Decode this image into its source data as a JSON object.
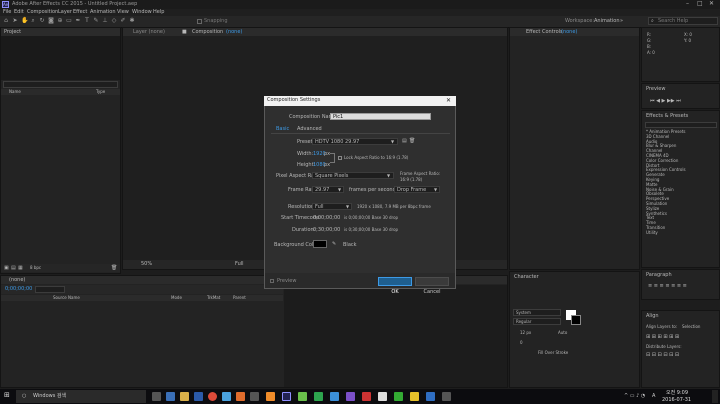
{
  "window": {
    "title": "Adobe After Effects CC 2015 - Untitled Project.aep",
    "app_badge": "Ae",
    "controls": [
      "–",
      "□",
      "✕"
    ]
  },
  "menu": [
    "File",
    "Edit",
    "Composition",
    "Layer",
    "Effect",
    "Animation",
    "View",
    "Window",
    "Help"
  ],
  "toolbar": {
    "snapping": "Snapping",
    "workspace_label": "Workspace:",
    "workspace_value": "Animation",
    "search_placeholder": "Search Help"
  },
  "project_panel": {
    "tab": "Project",
    "search_placeholder": "",
    "col_name": "Name",
    "col_type": "Type",
    "bpc": "8 bpc"
  },
  "viewer": {
    "tab_layer": "Layer (none)",
    "tab_comp": "Composition",
    "tab_comp_value": "(none)",
    "zoom": "50%",
    "resolution": "Full"
  },
  "effect_controls": {
    "tab": "Effect Controls",
    "value": "(none)"
  },
  "info_panel": {
    "label_x": "X: 0",
    "label_y": "Y: 0",
    "r": "R:",
    "g": "G:",
    "b": "B:",
    "a": "A: 0"
  },
  "preview_panel": {
    "tab": "Preview"
  },
  "effects_panel": {
    "tab": "Effects & Presets",
    "search_placeholder": "",
    "items": [
      "* Animation Presets",
      "3D Channel",
      "Audio",
      "Blur & Sharpen",
      "Channel",
      "CINEMA 4D",
      "Color Correction",
      "Distort",
      "Expression Controls",
      "Generate",
      "Keying",
      "Matte",
      "Noise & Grain",
      "Obsolete",
      "Perspective",
      "Simulation",
      "Stylize",
      "Synthetics",
      "Text",
      "Time",
      "Transition",
      "Utility"
    ]
  },
  "paragraph_panel": {
    "tab": "Paragraph"
  },
  "character_panel": {
    "tab": "Character",
    "font": "System",
    "style": "Regular",
    "size": "12 px",
    "auto": "Auto",
    "tracking": "0",
    "stroke": "Fill Over Stroke"
  },
  "align_panel": {
    "tab": "Align",
    "align_to_label": "Align Layers to:",
    "align_to_value": "Selection",
    "distribute": "Distribute Layers:"
  },
  "timeline": {
    "tab": "(none)",
    "time": "0;00;00;00",
    "col_source": "Source Name",
    "col_mode": "Mode",
    "col_trkmat": "TrkMat",
    "col_parent": "Parent"
  },
  "dialog": {
    "title": "Composition Settings",
    "comp_name_label": "Composition Name:",
    "comp_name_value": "Pic1",
    "tab_basic": "Basic",
    "tab_advanced": "Advanced",
    "preset_label": "Preset:",
    "preset_value": "HDTV 1080 29.97",
    "width_label": "Width:",
    "width_value": "1920",
    "width_unit": "px",
    "lock_label": "Lock Aspect Ratio to 16:9 (1.78)",
    "height_label": "Height:",
    "height_value": "1080",
    "height_unit": "px",
    "par_label": "Pixel Aspect Ratio:",
    "par_value": "Square Pixels",
    "frame_aspect_label": "Frame Aspect Ratio:",
    "frame_aspect_value": "16:9 (1.78)",
    "fps_label": "Frame Rate:",
    "fps_value": "29.97",
    "fps_unit": "frames per second",
    "drop_frame": "Drop Frame",
    "resolution_label": "Resolution:",
    "resolution_value": "Full",
    "resolution_info": "1920 x 1080, 7.9 MB per 8bpc frame",
    "start_tc_label": "Start Timecode:",
    "start_tc_value": "0;00;00;00",
    "start_tc_info": "is 0;00;00;00 Base 30 drop",
    "duration_label": "Duration:",
    "duration_value": "0;30;00;00",
    "duration_info": "is 0;30;00;00 Base 30 drop",
    "bg_label": "Background Color:",
    "bg_name": "Black",
    "preview_label": "Preview",
    "ok": "OK",
    "cancel": "Cancel"
  },
  "taskbar": {
    "search": "Windows 검색",
    "clock_time": "오전 9:09",
    "clock_date": "2016-07-31",
    "lang": "A"
  },
  "colors": {
    "accent": "#3d9ae6",
    "ok_button": "#1f5f8f",
    "dialog_bg": "#2f2f2f",
    "taskbar": "#0c0c0f"
  }
}
